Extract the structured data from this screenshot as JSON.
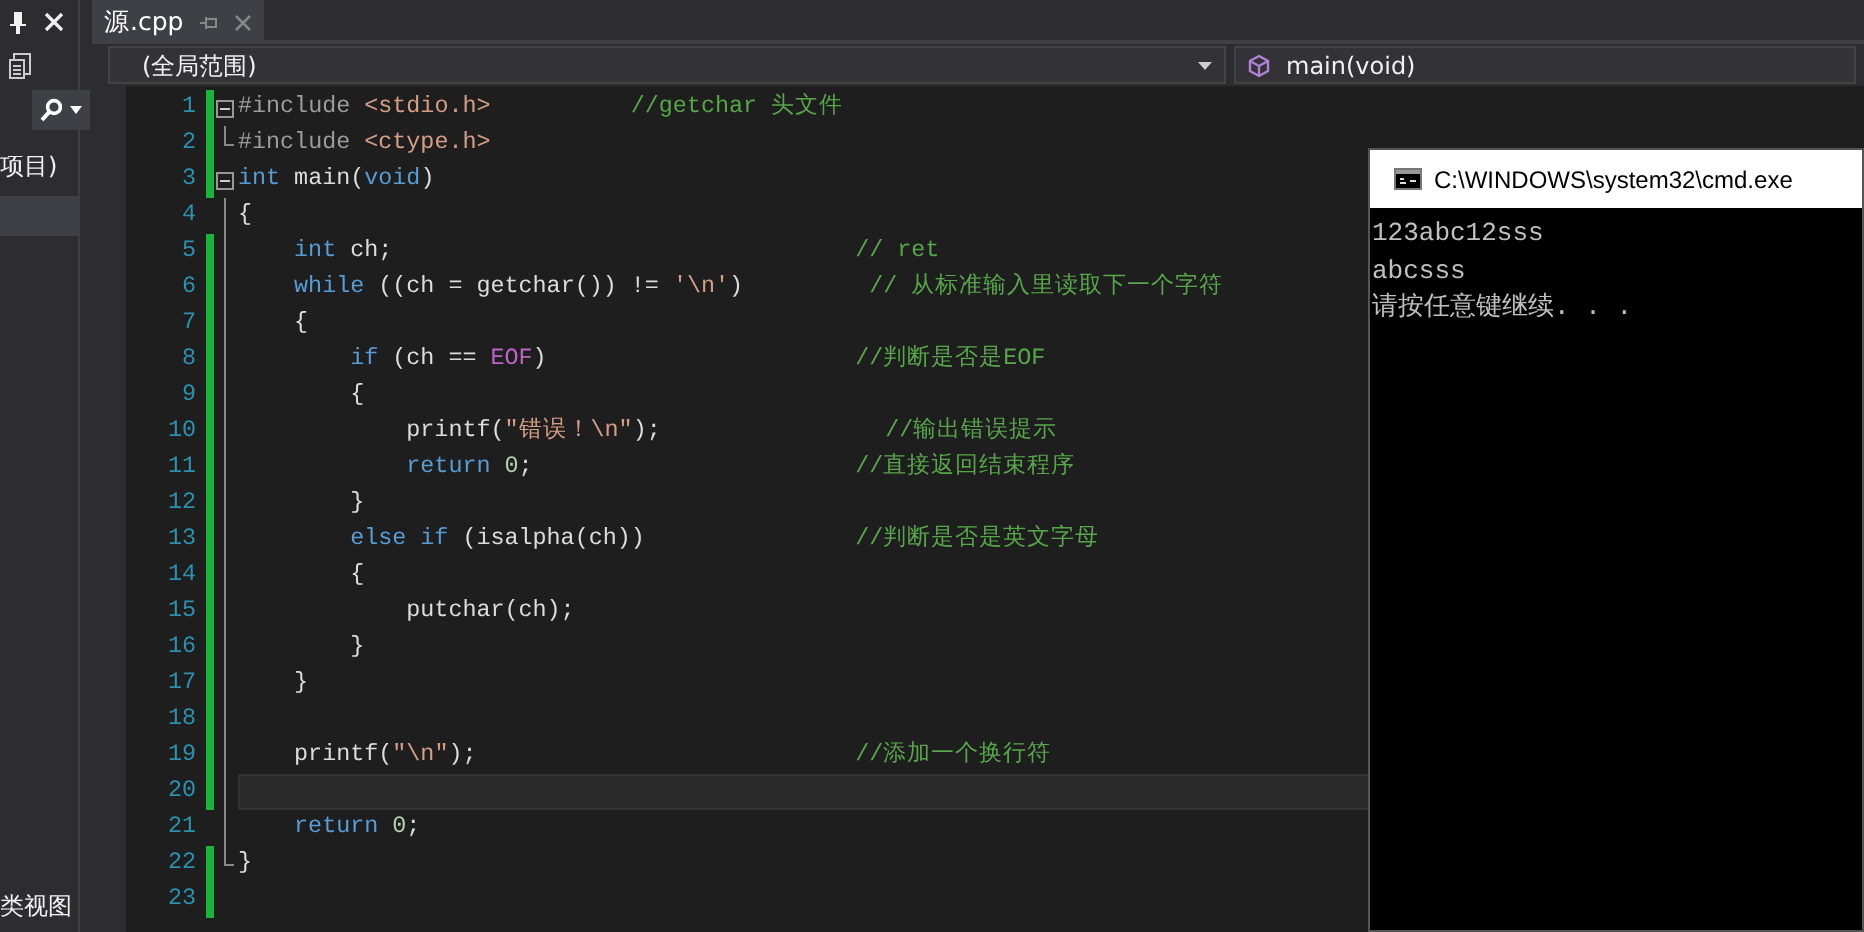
{
  "left_panel": {
    "item_label": "项目)",
    "bottom_tab": "类视图"
  },
  "tabs": [
    {
      "label": "源.cpp",
      "selected": true
    }
  ],
  "navigation": {
    "scope": "(全局范围)",
    "member": "main(void)"
  },
  "lines": [
    {
      "number": "1",
      "changed": true,
      "current": false,
      "fold": true,
      "code": [
        {
          "text": "#include ",
          "kind": "pre"
        },
        {
          "text": "<stdio.h>",
          "kind": "header"
        }
      ],
      "comment": "//getchar 头文件"
    },
    {
      "number": "2",
      "changed": true,
      "current": false,
      "fold": false,
      "code": [
        {
          "text": "#include ",
          "kind": "pre"
        },
        {
          "text": "<ctype.h>",
          "kind": "header"
        }
      ]
    },
    {
      "number": "3",
      "changed": true,
      "current": false,
      "fold": true,
      "code": [
        {
          "text": "int",
          "kind": "kw"
        },
        {
          "text": " main(",
          "kind": "plain"
        },
        {
          "text": "void",
          "kind": "kw"
        },
        {
          "text": ")",
          "kind": "plain"
        }
      ]
    },
    {
      "number": "4",
      "changed": false,
      "current": false,
      "fold": false,
      "code": [
        {
          "text": "{",
          "kind": "plain"
        }
      ]
    },
    {
      "number": "5",
      "changed": true,
      "current": false,
      "fold": false,
      "code": [
        {
          "text": "int",
          "kind": "kw"
        },
        {
          "text": " ch;",
          "kind": "plain"
        }
      ],
      "comment": "// ret"
    },
    {
      "number": "6",
      "changed": true,
      "current": false,
      "fold": false,
      "code": [
        {
          "text": "while",
          "kind": "kw"
        },
        {
          "text": " ((ch = getchar()) != ",
          "kind": "plain"
        },
        {
          "text": "'\\n'",
          "kind": "str"
        },
        {
          "text": ")",
          "kind": "plain"
        }
      ],
      "comment": "// 从标准输入里读取下一个字符"
    },
    {
      "number": "7",
      "changed": true,
      "current": false,
      "fold": false,
      "code": [
        {
          "text": "{",
          "kind": "plain"
        }
      ]
    },
    {
      "number": "8",
      "changed": true,
      "current": false,
      "fold": false,
      "code": [
        {
          "text": "if",
          "kind": "kw"
        },
        {
          "text": " (ch == ",
          "kind": "plain"
        },
        {
          "text": "EOF",
          "kind": "macro"
        },
        {
          "text": ")",
          "kind": "plain"
        }
      ],
      "comment": "//判断是否是EOF"
    },
    {
      "number": "9",
      "changed": true,
      "current": false,
      "fold": false,
      "code": [
        {
          "text": "{",
          "kind": "plain"
        }
      ]
    },
    {
      "number": "10",
      "changed": true,
      "current": false,
      "fold": false,
      "code": [
        {
          "text": "printf(",
          "kind": "plain"
        },
        {
          "text": "\"错误！\\n\"",
          "kind": "str"
        },
        {
          "text": ");",
          "kind": "plain"
        }
      ],
      "comment": "//输出错误提示"
    },
    {
      "number": "11",
      "changed": true,
      "current": false,
      "fold": false,
      "code": [
        {
          "text": "return ",
          "kind": "kw"
        },
        {
          "text": "0",
          "kind": "num"
        },
        {
          "text": ";",
          "kind": "plain"
        }
      ],
      "comment": "//直接返回结束程序"
    },
    {
      "number": "12",
      "changed": true,
      "current": false,
      "fold": false,
      "code": [
        {
          "text": "}",
          "kind": "plain"
        }
      ]
    },
    {
      "number": "13",
      "changed": true,
      "current": false,
      "fold": false,
      "code": [
        {
          "text": "else ",
          "kind": "kw"
        },
        {
          "text": "if",
          "kind": "kw"
        },
        {
          "text": " (isalpha(ch))",
          "kind": "plain"
        }
      ],
      "comment": "//判断是否是英文字母"
    },
    {
      "number": "14",
      "changed": true,
      "current": false,
      "fold": false,
      "code": [
        {
          "text": "{",
          "kind": "plain"
        }
      ]
    },
    {
      "number": "15",
      "changed": true,
      "current": false,
      "fold": false,
      "code": [
        {
          "text": "putchar(ch);",
          "kind": "plain"
        }
      ]
    },
    {
      "number": "16",
      "changed": true,
      "current": false,
      "fold": false,
      "code": [
        {
          "text": "}",
          "kind": "plain"
        }
      ]
    },
    {
      "number": "17",
      "changed": true,
      "current": false,
      "fold": false,
      "code": [
        {
          "text": "}",
          "kind": "plain"
        }
      ]
    },
    {
      "number": "18",
      "changed": true,
      "current": false,
      "fold": false
    },
    {
      "number": "19",
      "changed": true,
      "current": false,
      "fold": false,
      "code": [
        {
          "text": "printf(",
          "kind": "plain"
        },
        {
          "text": "\"\\n\"",
          "kind": "str"
        },
        {
          "text": ");",
          "kind": "plain"
        }
      ],
      "comment": "//添加一个换行符"
    },
    {
      "number": "20",
      "changed": true,
      "current": true,
      "fold": false
    },
    {
      "number": "21",
      "changed": false,
      "current": false,
      "fold": false,
      "code": [
        {
          "text": "return ",
          "kind": "kw"
        },
        {
          "text": "0",
          "kind": "num"
        },
        {
          "text": ";",
          "kind": "plain"
        }
      ]
    },
    {
      "number": "22",
      "changed": true,
      "current": false,
      "fold": false,
      "code": [
        {
          "text": "}",
          "kind": "plain"
        }
      ]
    },
    {
      "number": "23",
      "changed": true,
      "current": false,
      "fold": false
    }
  ],
  "console": {
    "title": "C:\\WINDOWS\\system32\\cmd.exe",
    "output": [
      "123abc12sss",
      "abcsss",
      "请按任意键继续. . ."
    ]
  }
}
